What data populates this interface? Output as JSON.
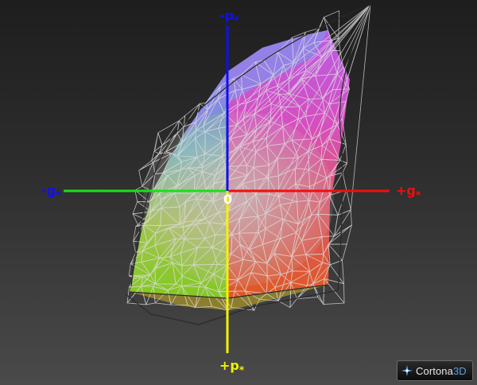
{
  "axes": {
    "neg_p": {
      "sign": "-p",
      "sub": "*",
      "color": "#1010ee"
    },
    "pos_p": {
      "sign": "+p",
      "sub": "*",
      "color": "#f2f200"
    },
    "neg_g": {
      "sign": "-g",
      "sub": "*",
      "color": "#1010ee"
    },
    "pos_g": {
      "sign": "+g",
      "sub": "*",
      "color": "#ee1010"
    },
    "green_line_color": "#18e018"
  },
  "origin": "0",
  "logo": {
    "name": "Cortona",
    "accent": "3D"
  }
}
